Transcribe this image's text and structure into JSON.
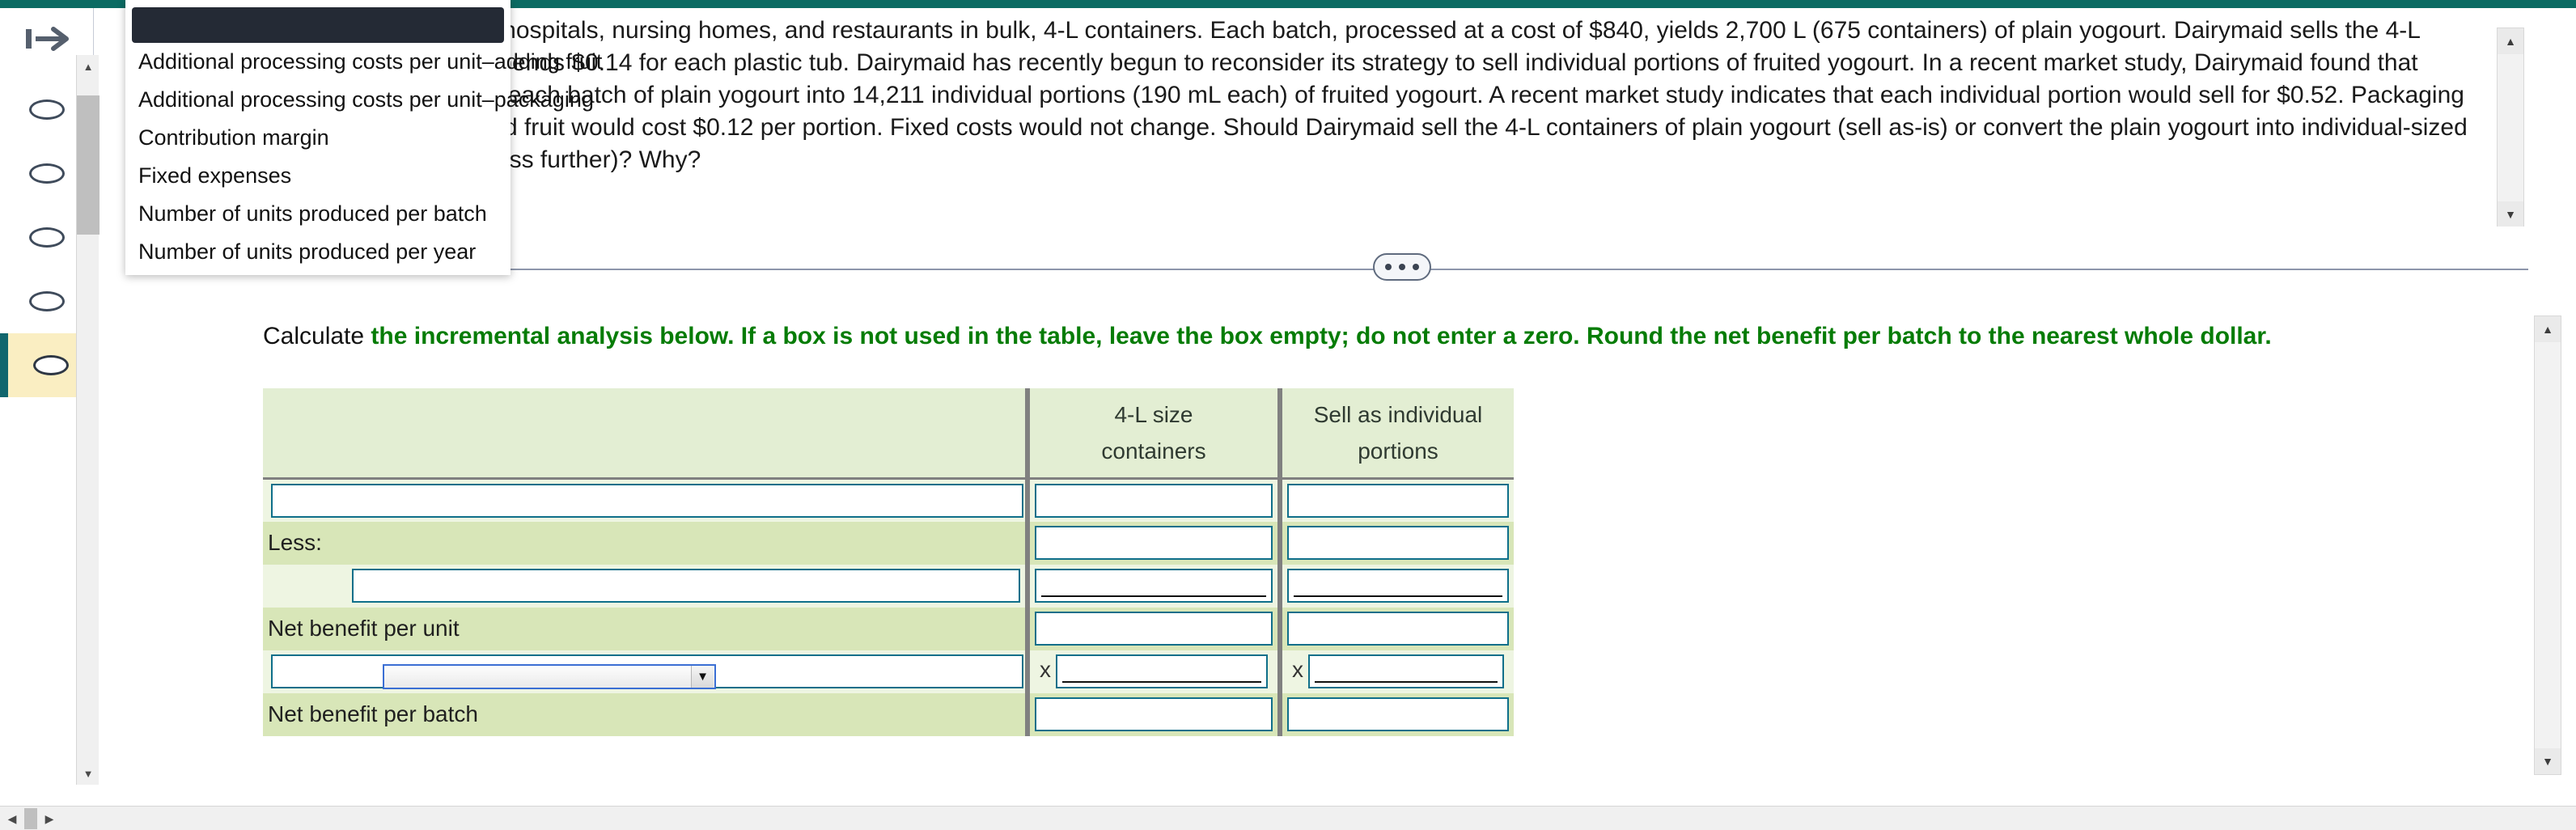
{
  "window": {
    "accent_teal": "#0b6b63",
    "highlight_yellow": "#faeec2",
    "green_instruction_color": "#067c06",
    "input_border_color": "#0f6f8a"
  },
  "rail": {
    "collapse_icon": "collapse-panel-arrow-icon",
    "items": [
      {
        "name": "question-nav-1",
        "state": "unanswered"
      },
      {
        "name": "question-nav-2",
        "state": "unanswered"
      },
      {
        "name": "question-nav-3",
        "state": "unanswered"
      },
      {
        "name": "question-nav-4",
        "state": "unanswered"
      },
      {
        "name": "question-nav-5",
        "state": "active"
      }
    ]
  },
  "statement": {
    "text": "Dairymaid sells plain yogourt to hospitals, nursing homes, and restaurants in bulk, 4-L containers. Each batch, processed at a cost of $840, yields 2,700 L (675 containers) of plain yogourt. Dairymaid sells the 4-L containers for $8.00 each and spends $0.14 for each plastic tub. Dairymaid has recently begun to reconsider its strategy to sell individual portions of fruited yogourt. In a recent market study, Dairymaid found that Dairymaid could further process each batch of plain yogourt into 14,211 individual portions (190 mL each) of fruited yogourt. A recent market study indicates that each individual portion would sell for $0.52. Packaging would cost $0.05 per portion, and fruit would cost $0.12 per portion. Fixed costs would not change. Should Dairymaid sell the 4-L containers of plain yogourt (sell as-is) or convert the plain yogourt into individual-sized portions of fruited yogourt (process further)? Why?"
  },
  "divider": {
    "dots_label": "more-content-indicator"
  },
  "instruction": {
    "prefix": "Calculate ",
    "bold_green": "the incremental analysis below. If a box is not used in the table, leave the box empty; do not enter a zero. Round the net benefit per batch to the nearest whole dollar."
  },
  "table": {
    "headers": {
      "row_label": "",
      "bulk_line1": "4-L size",
      "bulk_line2": "containers",
      "portions_line1": "Sell as individual",
      "portions_line2": "portions"
    },
    "rows": [
      {
        "label": "",
        "bulk": "",
        "portions": "",
        "kind": "input-wide-label",
        "x": false,
        "underline": false
      },
      {
        "label": "Less:",
        "bulk": "",
        "portions": "",
        "kind": "select",
        "x": false,
        "underline": false
      },
      {
        "label": "",
        "bulk": "",
        "portions": "",
        "kind": "input-label",
        "x": false,
        "underline": true
      },
      {
        "label": "Net benefit per unit",
        "bulk": "",
        "portions": "",
        "kind": "text",
        "x": false,
        "underline": false
      },
      {
        "label": "",
        "bulk": "",
        "portions": "",
        "kind": "input-label",
        "x": true,
        "underline": true
      },
      {
        "label": "Net benefit per batch",
        "bulk": "",
        "portions": "",
        "kind": "text",
        "x": false,
        "underline": false
      }
    ],
    "multiply_symbol": "x"
  },
  "select_control": {
    "value": "",
    "caret_icon": "chevron-down-icon"
  },
  "dropdown": {
    "open": true,
    "selected_index": 0,
    "options": [
      "",
      "Additional processing costs per unit–adding fruit",
      "Additional processing costs per unit–packaging",
      "Contribution margin",
      "Fixed expenses",
      "Number of units produced per batch",
      "Number of units produced per year"
    ]
  },
  "scrollbars": {
    "up_arrow": "▲",
    "down_arrow": "▼",
    "left_arrow": "◀",
    "right_arrow": "▶"
  }
}
